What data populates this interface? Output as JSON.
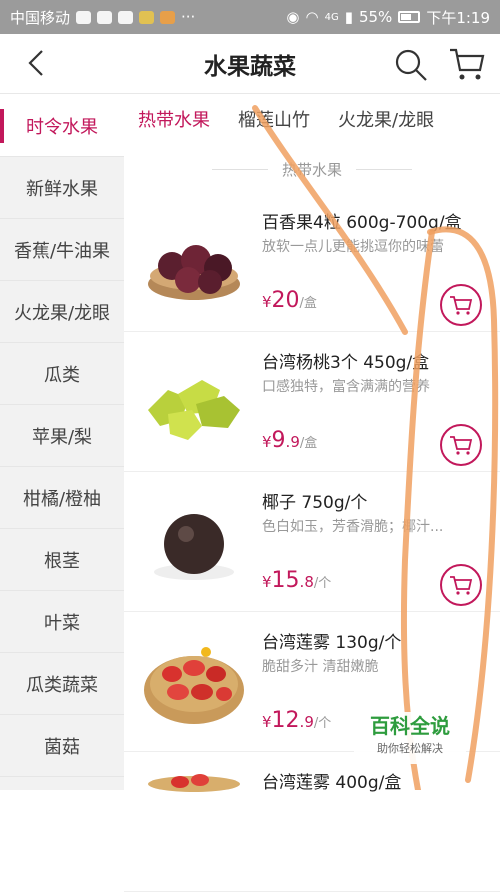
{
  "statusbar": {
    "carrier": "中国移动",
    "battery_text": "55%",
    "network": "4G",
    "time": "下午1:19"
  },
  "header": {
    "title": "水果蔬菜"
  },
  "sidebar": {
    "items": [
      {
        "label": "时令水果"
      },
      {
        "label": "新鲜水果"
      },
      {
        "label": "香蕉/牛油果"
      },
      {
        "label": "火龙果/龙眼"
      },
      {
        "label": "瓜类"
      },
      {
        "label": "苹果/梨"
      },
      {
        "label": "柑橘/橙柚"
      },
      {
        "label": "根茎"
      },
      {
        "label": "叶菜"
      },
      {
        "label": "瓜类蔬菜"
      },
      {
        "label": "菌菇"
      }
    ]
  },
  "tabs": [
    {
      "label": "热带水果"
    },
    {
      "label": "榴莲山竹"
    },
    {
      "label": "火龙果/龙眼"
    }
  ],
  "section": {
    "title": "热带水果"
  },
  "products": [
    {
      "name": "百香果4粒 600g-700g/盒",
      "desc": "放软一点儿更能挑逗你的味蕾",
      "currency": "¥",
      "price_int": "20",
      "price_dec": "",
      "unit": "/盒"
    },
    {
      "name": "台湾杨桃3个 450g/盒",
      "desc": "口感独特，富含满满的营养",
      "currency": "¥",
      "price_int": "9",
      "price_dec": ".9",
      "unit": "/盒"
    },
    {
      "name": "椰子 750g/个",
      "desc": "色白如玉，芳香滑脆；椰汁...",
      "currency": "¥",
      "price_int": "15",
      "price_dec": ".8",
      "unit": "/个"
    },
    {
      "name": "台湾莲雾 130g/个",
      "desc": "脆甜多汁 清甜嫩脆",
      "currency": "¥",
      "price_int": "12",
      "price_dec": ".9",
      "unit": "/个"
    },
    {
      "name": "台湾莲雾 400g/盒",
      "desc": "",
      "currency": "",
      "price_int": "",
      "price_dec": "",
      "unit": ""
    }
  ],
  "watermark": {
    "main": "百科全说",
    "sub": "助你轻松解决"
  },
  "colors": {
    "accent": "#c2185b",
    "annotation": "#f0a060"
  }
}
